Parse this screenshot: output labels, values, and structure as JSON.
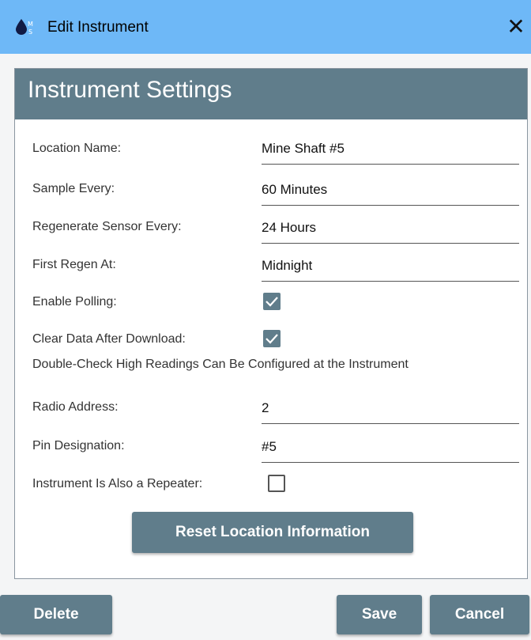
{
  "window": {
    "title": "Edit Instrument",
    "close_glyph": "✕",
    "icon": "water-drop-app-icon"
  },
  "panel": {
    "title": "Instrument Settings"
  },
  "fields": [
    {
      "label": "Location Name:",
      "value": "Mine Shaft #5"
    },
    {
      "label": "Sample Every:",
      "value": "60 Minutes"
    },
    {
      "label": "Regenerate Sensor Every:",
      "value": "24 Hours"
    },
    {
      "label": "First Regen At:",
      "value": "Midnight"
    }
  ],
  "checks": {
    "enable_polling": {
      "label": "Enable Polling:",
      "checked": true
    },
    "clear_data": {
      "label": "Clear Data After Download:",
      "checked": true
    },
    "repeater": {
      "label": "Instrument Is Also a Repeater:",
      "checked": false
    }
  },
  "note": "Double-Check High Readings Can Be Configured at the Instrument",
  "fields2": [
    {
      "label": "Radio Address:",
      "value": "2"
    },
    {
      "label": "Pin Designation:",
      "value": "#5"
    }
  ],
  "buttons": {
    "reset": "Reset Location Information",
    "delete": "Delete",
    "save": "Save",
    "cancel": "Cancel"
  },
  "colors": {
    "titlebar": "#6eb8f7",
    "accent": "#607d8b"
  }
}
